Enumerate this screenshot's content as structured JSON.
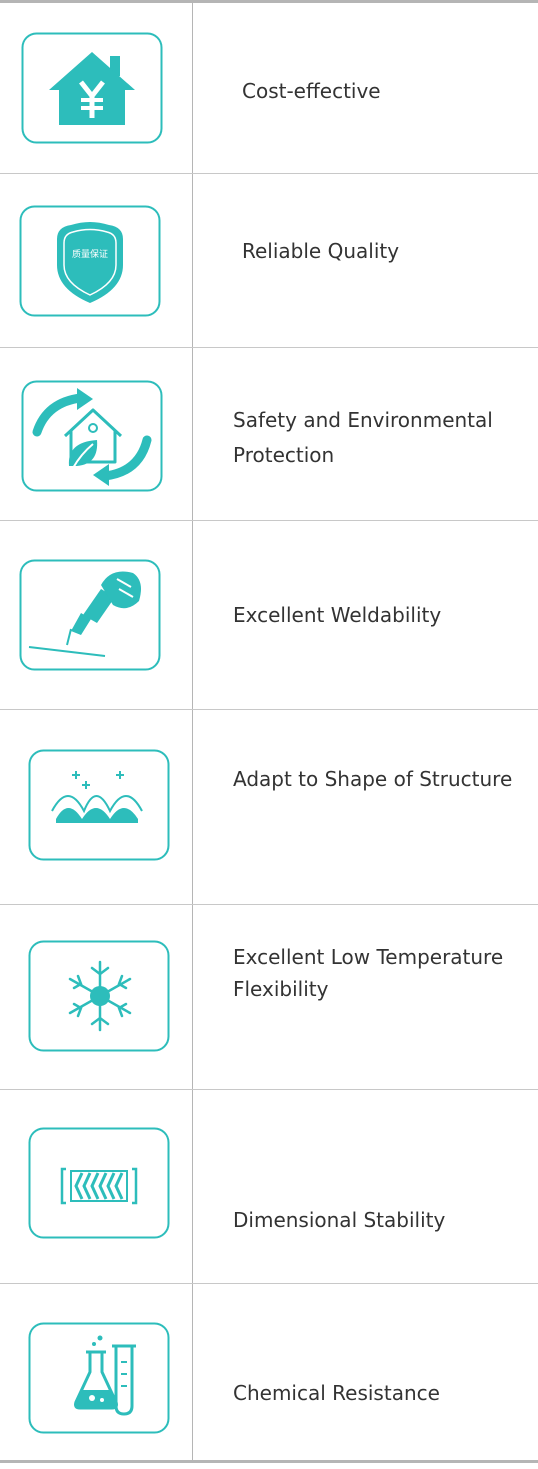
{
  "features": [
    {
      "icon": "yen-house-icon",
      "label": "Cost-effective"
    },
    {
      "icon": "quality-shield-icon",
      "badge": "质量保证",
      "label": "Reliable Quality"
    },
    {
      "icon": "eco-house-icon",
      "label_line1": "Safety and Environmental",
      "label_line2": "Protection"
    },
    {
      "icon": "welding-hand-icon",
      "label": "Excellent Weldability"
    },
    {
      "icon": "adaptive-waves-icon",
      "label": "Adapt to Shape of Structure"
    },
    {
      "icon": "snowflake-icon",
      "label_line1": "Excellent Low Temperature",
      "label_line2": "Flexibility"
    },
    {
      "icon": "stable-frame-icon",
      "label": "Dimensional Stability"
    },
    {
      "icon": "chemical-flask-icon",
      "label": "Chemical Resistance"
    }
  ],
  "colors": {
    "accent": "#2dbdbb",
    "border": "#b5b5b5",
    "text": "#333333"
  }
}
